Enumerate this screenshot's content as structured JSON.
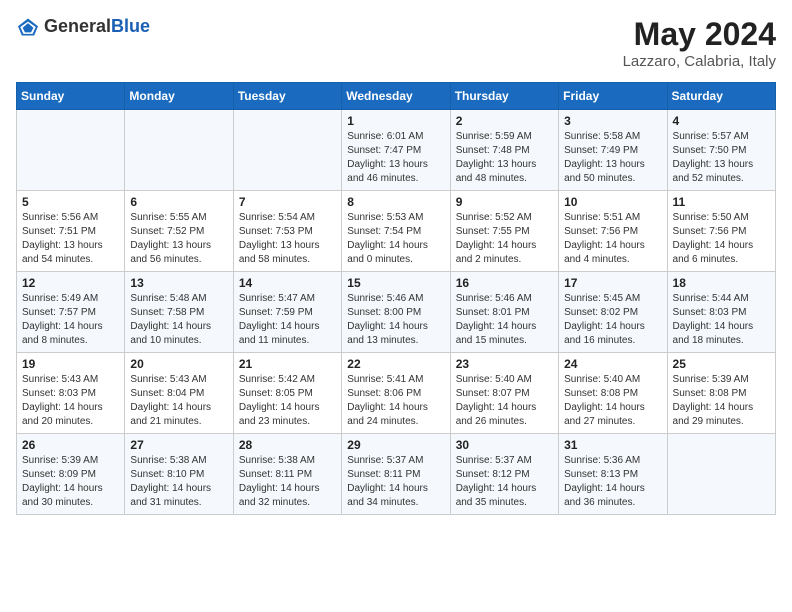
{
  "header": {
    "logo": {
      "text_general": "General",
      "text_blue": "Blue"
    },
    "title": "May 2024",
    "location": "Lazzaro, Calabria, Italy"
  },
  "calendar": {
    "days_of_week": [
      "Sunday",
      "Monday",
      "Tuesday",
      "Wednesday",
      "Thursday",
      "Friday",
      "Saturday"
    ],
    "weeks": [
      [
        {
          "day": "",
          "content": ""
        },
        {
          "day": "",
          "content": ""
        },
        {
          "day": "",
          "content": ""
        },
        {
          "day": "1",
          "content": "Sunrise: 6:01 AM\nSunset: 7:47 PM\nDaylight: 13 hours\nand 46 minutes."
        },
        {
          "day": "2",
          "content": "Sunrise: 5:59 AM\nSunset: 7:48 PM\nDaylight: 13 hours\nand 48 minutes."
        },
        {
          "day": "3",
          "content": "Sunrise: 5:58 AM\nSunset: 7:49 PM\nDaylight: 13 hours\nand 50 minutes."
        },
        {
          "day": "4",
          "content": "Sunrise: 5:57 AM\nSunset: 7:50 PM\nDaylight: 13 hours\nand 52 minutes."
        }
      ],
      [
        {
          "day": "5",
          "content": "Sunrise: 5:56 AM\nSunset: 7:51 PM\nDaylight: 13 hours\nand 54 minutes."
        },
        {
          "day": "6",
          "content": "Sunrise: 5:55 AM\nSunset: 7:52 PM\nDaylight: 13 hours\nand 56 minutes."
        },
        {
          "day": "7",
          "content": "Sunrise: 5:54 AM\nSunset: 7:53 PM\nDaylight: 13 hours\nand 58 minutes."
        },
        {
          "day": "8",
          "content": "Sunrise: 5:53 AM\nSunset: 7:54 PM\nDaylight: 14 hours\nand 0 minutes."
        },
        {
          "day": "9",
          "content": "Sunrise: 5:52 AM\nSunset: 7:55 PM\nDaylight: 14 hours\nand 2 minutes."
        },
        {
          "day": "10",
          "content": "Sunrise: 5:51 AM\nSunset: 7:56 PM\nDaylight: 14 hours\nand 4 minutes."
        },
        {
          "day": "11",
          "content": "Sunrise: 5:50 AM\nSunset: 7:56 PM\nDaylight: 14 hours\nand 6 minutes."
        }
      ],
      [
        {
          "day": "12",
          "content": "Sunrise: 5:49 AM\nSunset: 7:57 PM\nDaylight: 14 hours\nand 8 minutes."
        },
        {
          "day": "13",
          "content": "Sunrise: 5:48 AM\nSunset: 7:58 PM\nDaylight: 14 hours\nand 10 minutes."
        },
        {
          "day": "14",
          "content": "Sunrise: 5:47 AM\nSunset: 7:59 PM\nDaylight: 14 hours\nand 11 minutes."
        },
        {
          "day": "15",
          "content": "Sunrise: 5:46 AM\nSunset: 8:00 PM\nDaylight: 14 hours\nand 13 minutes."
        },
        {
          "day": "16",
          "content": "Sunrise: 5:46 AM\nSunset: 8:01 PM\nDaylight: 14 hours\nand 15 minutes."
        },
        {
          "day": "17",
          "content": "Sunrise: 5:45 AM\nSunset: 8:02 PM\nDaylight: 14 hours\nand 16 minutes."
        },
        {
          "day": "18",
          "content": "Sunrise: 5:44 AM\nSunset: 8:03 PM\nDaylight: 14 hours\nand 18 minutes."
        }
      ],
      [
        {
          "day": "19",
          "content": "Sunrise: 5:43 AM\nSunset: 8:03 PM\nDaylight: 14 hours\nand 20 minutes."
        },
        {
          "day": "20",
          "content": "Sunrise: 5:43 AM\nSunset: 8:04 PM\nDaylight: 14 hours\nand 21 minutes."
        },
        {
          "day": "21",
          "content": "Sunrise: 5:42 AM\nSunset: 8:05 PM\nDaylight: 14 hours\nand 23 minutes."
        },
        {
          "day": "22",
          "content": "Sunrise: 5:41 AM\nSunset: 8:06 PM\nDaylight: 14 hours\nand 24 minutes."
        },
        {
          "day": "23",
          "content": "Sunrise: 5:40 AM\nSunset: 8:07 PM\nDaylight: 14 hours\nand 26 minutes."
        },
        {
          "day": "24",
          "content": "Sunrise: 5:40 AM\nSunset: 8:08 PM\nDaylight: 14 hours\nand 27 minutes."
        },
        {
          "day": "25",
          "content": "Sunrise: 5:39 AM\nSunset: 8:08 PM\nDaylight: 14 hours\nand 29 minutes."
        }
      ],
      [
        {
          "day": "26",
          "content": "Sunrise: 5:39 AM\nSunset: 8:09 PM\nDaylight: 14 hours\nand 30 minutes."
        },
        {
          "day": "27",
          "content": "Sunrise: 5:38 AM\nSunset: 8:10 PM\nDaylight: 14 hours\nand 31 minutes."
        },
        {
          "day": "28",
          "content": "Sunrise: 5:38 AM\nSunset: 8:11 PM\nDaylight: 14 hours\nand 32 minutes."
        },
        {
          "day": "29",
          "content": "Sunrise: 5:37 AM\nSunset: 8:11 PM\nDaylight: 14 hours\nand 34 minutes."
        },
        {
          "day": "30",
          "content": "Sunrise: 5:37 AM\nSunset: 8:12 PM\nDaylight: 14 hours\nand 35 minutes."
        },
        {
          "day": "31",
          "content": "Sunrise: 5:36 AM\nSunset: 8:13 PM\nDaylight: 14 hours\nand 36 minutes."
        },
        {
          "day": "",
          "content": ""
        }
      ]
    ]
  }
}
